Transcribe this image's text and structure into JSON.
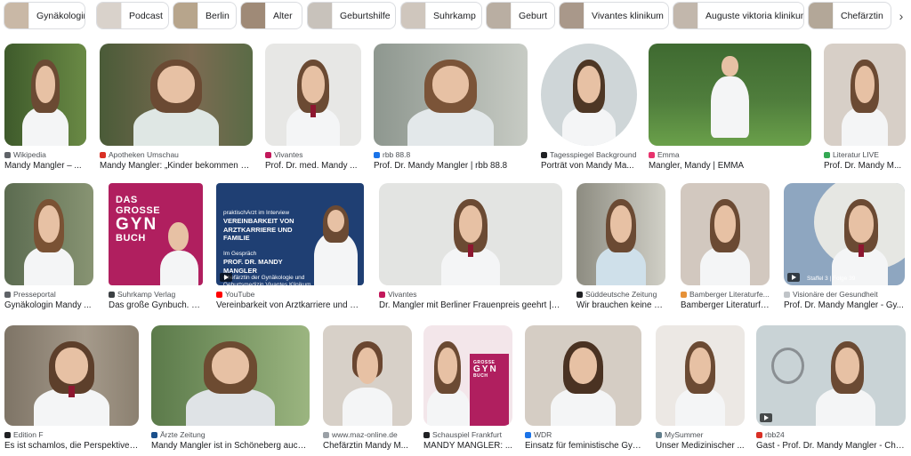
{
  "chips": [
    {
      "label": "Gynäkologin",
      "thumb": "#c9b8a6"
    },
    {
      "label": "Podcast",
      "thumb": "#d9d2cb"
    },
    {
      "label": "Berlin",
      "thumb": "#b7a58c"
    },
    {
      "label": "Alter",
      "thumb": "#9f8a77"
    },
    {
      "label": "Geburtshilfe",
      "thumb": "#c8c2bb"
    },
    {
      "label": "Suhrkamp",
      "thumb": "#cfc6bd"
    },
    {
      "label": "Geburt",
      "thumb": "#b9aea2"
    },
    {
      "label": "Vivantes klinikum",
      "thumb": "#a9988a"
    },
    {
      "label": "Auguste viktoria klinikum",
      "thumb": "#c2b7ac"
    },
    {
      "label": "Chefärztin",
      "thumb": "#b3a798"
    }
  ],
  "results": [
    {
      "source": "Wikipedia",
      "title": "Mandy Mangler – ...",
      "fav": "#5f6368",
      "bg": "#4f6b37"
    },
    {
      "source": "Apotheken Umschau",
      "title": "Mandy Mangler: „Kinder bekommen ka...",
      "fav": "#d93025",
      "bg": "#5d6b4a"
    },
    {
      "source": "Vivantes",
      "title": "Prof. Dr. med. Mandy ...",
      "fav": "#c2185b",
      "bg": "#e6e6e4"
    },
    {
      "source": "rbb 88.8",
      "title": "Prof. Dr. Mandy Mangler | rbb 88.8",
      "fav": "#1a73e8",
      "bg": "#9aa39b"
    },
    {
      "source": "Tagesspiegel Background",
      "title": "Porträt von Mandy Ma...",
      "fav": "#202124",
      "bg": "#cfd6d8"
    },
    {
      "source": "Emma",
      "title": "Mangler, Mandy | EMMA",
      "fav": "#e8336d",
      "bg": "#4c7a3a"
    },
    {
      "source": "Literatur LIVE",
      "title": "Prof. Dr. Mandy M...",
      "fav": "#34a853",
      "bg": "#cdc2b6"
    },
    {
      "source": "Presseportal",
      "title": "Gynäkologin Mandy ...",
      "fav": "#5f6368",
      "bg": "#6f7a62"
    },
    {
      "source": "Suhrkamp Verlag",
      "title": "Das große Gynbuch. B...",
      "fav": "#3c4043",
      "bg": "#b01f5f",
      "book_line1": "DAS",
      "book_line2": "GROSSE",
      "book_line3": "GYN",
      "book_line4": "BUCH"
    },
    {
      "source": "YouTube",
      "title": "Vereinbarkeit von Arztkarriere und Fa...",
      "fav": "#ff0000",
      "bg": "#1f3f73",
      "yt_small": "praktischArzt im Interview",
      "yt_big": "VEREINBARKEIT VON ARZTKARRIERE UND FAMILIE",
      "yt_small2": "Im Gespräch",
      "yt_name": "PROF. DR. MANDY MANGLER",
      "yt_role": "Chefärztin der Gynäkologie und Geburtsmedizin Vivantes Klinikum GmbH"
    },
    {
      "source": "Vivantes",
      "title": "Dr. Mangler mit Berliner Frauenpreis geehrt | Vi...",
      "fav": "#c2185b",
      "bg": "#e3e4e2"
    },
    {
      "source": "Süddeutsche Zeitung",
      "title": "Wir brauchen keine M...",
      "fav": "#202124",
      "bg": "#b9b5ab"
    },
    {
      "source": "Bamberger Literaturfe...",
      "title": "Bamberger Literaturfe...",
      "fav": "#e69138",
      "bg": "#d2c8bf"
    },
    {
      "source": "Visionäre der Gesundheit",
      "title": "Prof. Dr. Mandy Mangler - Gy...",
      "fav": "#c0c4c8",
      "bg": "#8ea6c0",
      "badge": "Staffel 3 | Folge 39"
    },
    {
      "source": "Edition F",
      "title": "Es ist schamlos, die Perspektive ...",
      "fav": "#202124",
      "bg": "#8b7f70"
    },
    {
      "source": "Ärzte Zeitung",
      "title": "Mandy Mangler ist in Schöneberg auch ...",
      "fav": "#1a4f8b",
      "bg": "#7f9a64"
    },
    {
      "source": "www.maz-online.de",
      "title": "Chefärztin Mandy M...",
      "fav": "#9aa0a6",
      "bg": "#d7d0c8"
    },
    {
      "source": "Schauspiel Frankfurt",
      "title": "MANDY MANGLER: ...",
      "fav": "#202124",
      "bg": "#e7a8b9",
      "book_line2": "GROSSE",
      "book_line3": "GYN",
      "book_line4": "BUCH"
    },
    {
      "source": "WDR",
      "title": "Einsatz für feministische Gyn...",
      "fav": "#1a73e8",
      "bg": "#d5cdc4"
    },
    {
      "source": "MySummer",
      "title": "Unser Medizinischer ...",
      "fav": "#607d8b",
      "bg": "#ece8e4"
    },
    {
      "source": "rbb24",
      "title": "Gast - Prof. Dr. Mandy Mangler - Che...",
      "fav": "#d93025",
      "bg": "#c9d3d6"
    }
  ],
  "more_chips_icon": "chevron-right-icon"
}
